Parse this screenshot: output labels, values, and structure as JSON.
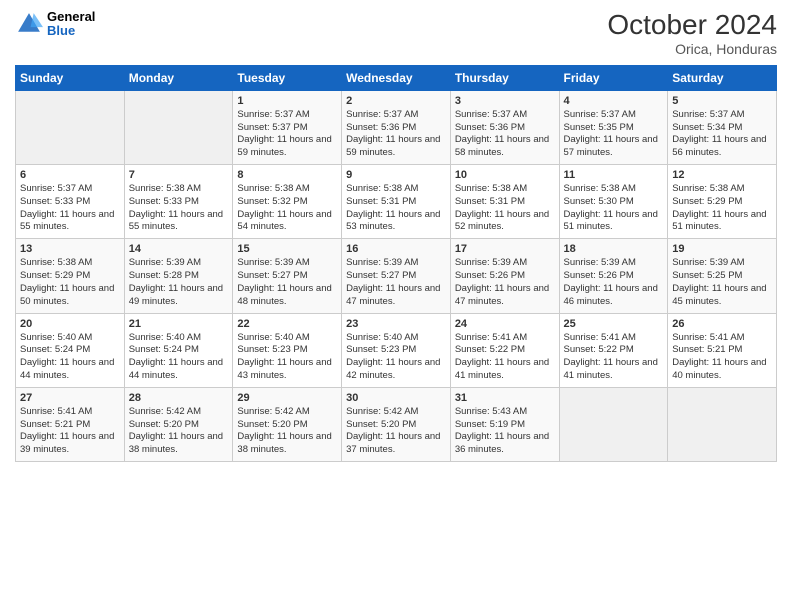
{
  "logo": {
    "general": "General",
    "blue": "Blue"
  },
  "title": "October 2024",
  "subtitle": "Orica, Honduras",
  "days_of_week": [
    "Sunday",
    "Monday",
    "Tuesday",
    "Wednesday",
    "Thursday",
    "Friday",
    "Saturday"
  ],
  "weeks": [
    [
      {
        "day": "",
        "sunrise": "",
        "sunset": "",
        "daylight": ""
      },
      {
        "day": "",
        "sunrise": "",
        "sunset": "",
        "daylight": ""
      },
      {
        "day": "1",
        "sunrise": "Sunrise: 5:37 AM",
        "sunset": "Sunset: 5:37 PM",
        "daylight": "Daylight: 11 hours and 59 minutes."
      },
      {
        "day": "2",
        "sunrise": "Sunrise: 5:37 AM",
        "sunset": "Sunset: 5:36 PM",
        "daylight": "Daylight: 11 hours and 59 minutes."
      },
      {
        "day": "3",
        "sunrise": "Sunrise: 5:37 AM",
        "sunset": "Sunset: 5:36 PM",
        "daylight": "Daylight: 11 hours and 58 minutes."
      },
      {
        "day": "4",
        "sunrise": "Sunrise: 5:37 AM",
        "sunset": "Sunset: 5:35 PM",
        "daylight": "Daylight: 11 hours and 57 minutes."
      },
      {
        "day": "5",
        "sunrise": "Sunrise: 5:37 AM",
        "sunset": "Sunset: 5:34 PM",
        "daylight": "Daylight: 11 hours and 56 minutes."
      }
    ],
    [
      {
        "day": "6",
        "sunrise": "Sunrise: 5:37 AM",
        "sunset": "Sunset: 5:33 PM",
        "daylight": "Daylight: 11 hours and 55 minutes."
      },
      {
        "day": "7",
        "sunrise": "Sunrise: 5:38 AM",
        "sunset": "Sunset: 5:33 PM",
        "daylight": "Daylight: 11 hours and 55 minutes."
      },
      {
        "day": "8",
        "sunrise": "Sunrise: 5:38 AM",
        "sunset": "Sunset: 5:32 PM",
        "daylight": "Daylight: 11 hours and 54 minutes."
      },
      {
        "day": "9",
        "sunrise": "Sunrise: 5:38 AM",
        "sunset": "Sunset: 5:31 PM",
        "daylight": "Daylight: 11 hours and 53 minutes."
      },
      {
        "day": "10",
        "sunrise": "Sunrise: 5:38 AM",
        "sunset": "Sunset: 5:31 PM",
        "daylight": "Daylight: 11 hours and 52 minutes."
      },
      {
        "day": "11",
        "sunrise": "Sunrise: 5:38 AM",
        "sunset": "Sunset: 5:30 PM",
        "daylight": "Daylight: 11 hours and 51 minutes."
      },
      {
        "day": "12",
        "sunrise": "Sunrise: 5:38 AM",
        "sunset": "Sunset: 5:29 PM",
        "daylight": "Daylight: 11 hours and 51 minutes."
      }
    ],
    [
      {
        "day": "13",
        "sunrise": "Sunrise: 5:38 AM",
        "sunset": "Sunset: 5:29 PM",
        "daylight": "Daylight: 11 hours and 50 minutes."
      },
      {
        "day": "14",
        "sunrise": "Sunrise: 5:39 AM",
        "sunset": "Sunset: 5:28 PM",
        "daylight": "Daylight: 11 hours and 49 minutes."
      },
      {
        "day": "15",
        "sunrise": "Sunrise: 5:39 AM",
        "sunset": "Sunset: 5:27 PM",
        "daylight": "Daylight: 11 hours and 48 minutes."
      },
      {
        "day": "16",
        "sunrise": "Sunrise: 5:39 AM",
        "sunset": "Sunset: 5:27 PM",
        "daylight": "Daylight: 11 hours and 47 minutes."
      },
      {
        "day": "17",
        "sunrise": "Sunrise: 5:39 AM",
        "sunset": "Sunset: 5:26 PM",
        "daylight": "Daylight: 11 hours and 47 minutes."
      },
      {
        "day": "18",
        "sunrise": "Sunrise: 5:39 AM",
        "sunset": "Sunset: 5:26 PM",
        "daylight": "Daylight: 11 hours and 46 minutes."
      },
      {
        "day": "19",
        "sunrise": "Sunrise: 5:39 AM",
        "sunset": "Sunset: 5:25 PM",
        "daylight": "Daylight: 11 hours and 45 minutes."
      }
    ],
    [
      {
        "day": "20",
        "sunrise": "Sunrise: 5:40 AM",
        "sunset": "Sunset: 5:24 PM",
        "daylight": "Daylight: 11 hours and 44 minutes."
      },
      {
        "day": "21",
        "sunrise": "Sunrise: 5:40 AM",
        "sunset": "Sunset: 5:24 PM",
        "daylight": "Daylight: 11 hours and 44 minutes."
      },
      {
        "day": "22",
        "sunrise": "Sunrise: 5:40 AM",
        "sunset": "Sunset: 5:23 PM",
        "daylight": "Daylight: 11 hours and 43 minutes."
      },
      {
        "day": "23",
        "sunrise": "Sunrise: 5:40 AM",
        "sunset": "Sunset: 5:23 PM",
        "daylight": "Daylight: 11 hours and 42 minutes."
      },
      {
        "day": "24",
        "sunrise": "Sunrise: 5:41 AM",
        "sunset": "Sunset: 5:22 PM",
        "daylight": "Daylight: 11 hours and 41 minutes."
      },
      {
        "day": "25",
        "sunrise": "Sunrise: 5:41 AM",
        "sunset": "Sunset: 5:22 PM",
        "daylight": "Daylight: 11 hours and 41 minutes."
      },
      {
        "day": "26",
        "sunrise": "Sunrise: 5:41 AM",
        "sunset": "Sunset: 5:21 PM",
        "daylight": "Daylight: 11 hours and 40 minutes."
      }
    ],
    [
      {
        "day": "27",
        "sunrise": "Sunrise: 5:41 AM",
        "sunset": "Sunset: 5:21 PM",
        "daylight": "Daylight: 11 hours and 39 minutes."
      },
      {
        "day": "28",
        "sunrise": "Sunrise: 5:42 AM",
        "sunset": "Sunset: 5:20 PM",
        "daylight": "Daylight: 11 hours and 38 minutes."
      },
      {
        "day": "29",
        "sunrise": "Sunrise: 5:42 AM",
        "sunset": "Sunset: 5:20 PM",
        "daylight": "Daylight: 11 hours and 38 minutes."
      },
      {
        "day": "30",
        "sunrise": "Sunrise: 5:42 AM",
        "sunset": "Sunset: 5:20 PM",
        "daylight": "Daylight: 11 hours and 37 minutes."
      },
      {
        "day": "31",
        "sunrise": "Sunrise: 5:43 AM",
        "sunset": "Sunset: 5:19 PM",
        "daylight": "Daylight: 11 hours and 36 minutes."
      },
      {
        "day": "",
        "sunrise": "",
        "sunset": "",
        "daylight": ""
      },
      {
        "day": "",
        "sunrise": "",
        "sunset": "",
        "daylight": ""
      }
    ]
  ]
}
